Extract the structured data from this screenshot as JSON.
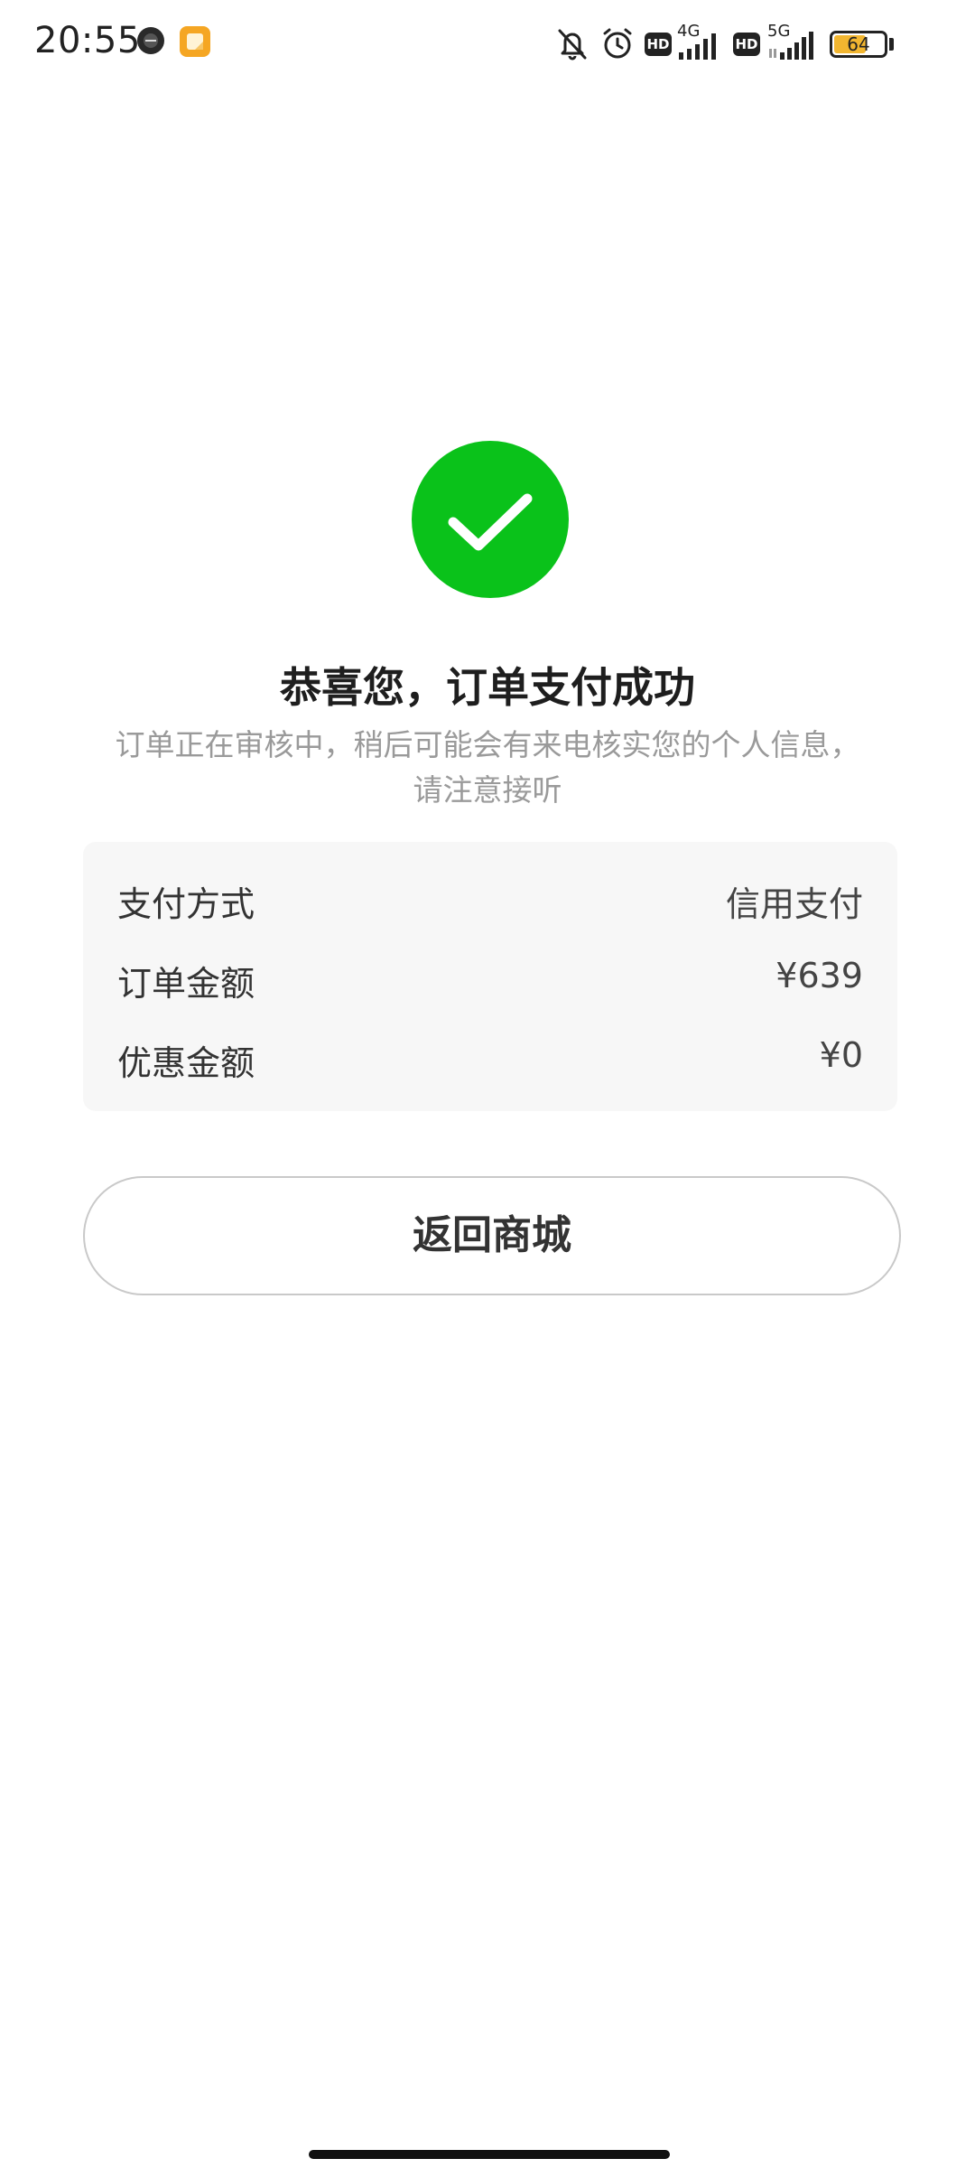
{
  "status_bar": {
    "time": "20:55",
    "network_1": "4G",
    "network_2": "5G",
    "hd_label": "HD",
    "battery_percent": 64,
    "battery_label": "64",
    "icons": [
      "camera-app-icon",
      "notes-app-icon",
      "mute-bell-icon",
      "alarm-icon",
      "hd-icon",
      "signal-icon",
      "battery-icon"
    ]
  },
  "success": {
    "icon": "checkmark-circle-icon",
    "accent_color": "#0ac21a",
    "title": "恭喜您，订单支付成功",
    "subtitle_line1": "订单正在审核中，稍后可能会有来电核实您的个人信息，",
    "subtitle_line2": "请注意接听"
  },
  "order_info": {
    "rows": [
      {
        "label": "支付方式",
        "value": "信用支付"
      },
      {
        "label": "订单金额",
        "value": "¥639"
      },
      {
        "label": "优惠金额",
        "value": "¥0"
      }
    ]
  },
  "actions": {
    "back_to_mall": "返回商城"
  }
}
